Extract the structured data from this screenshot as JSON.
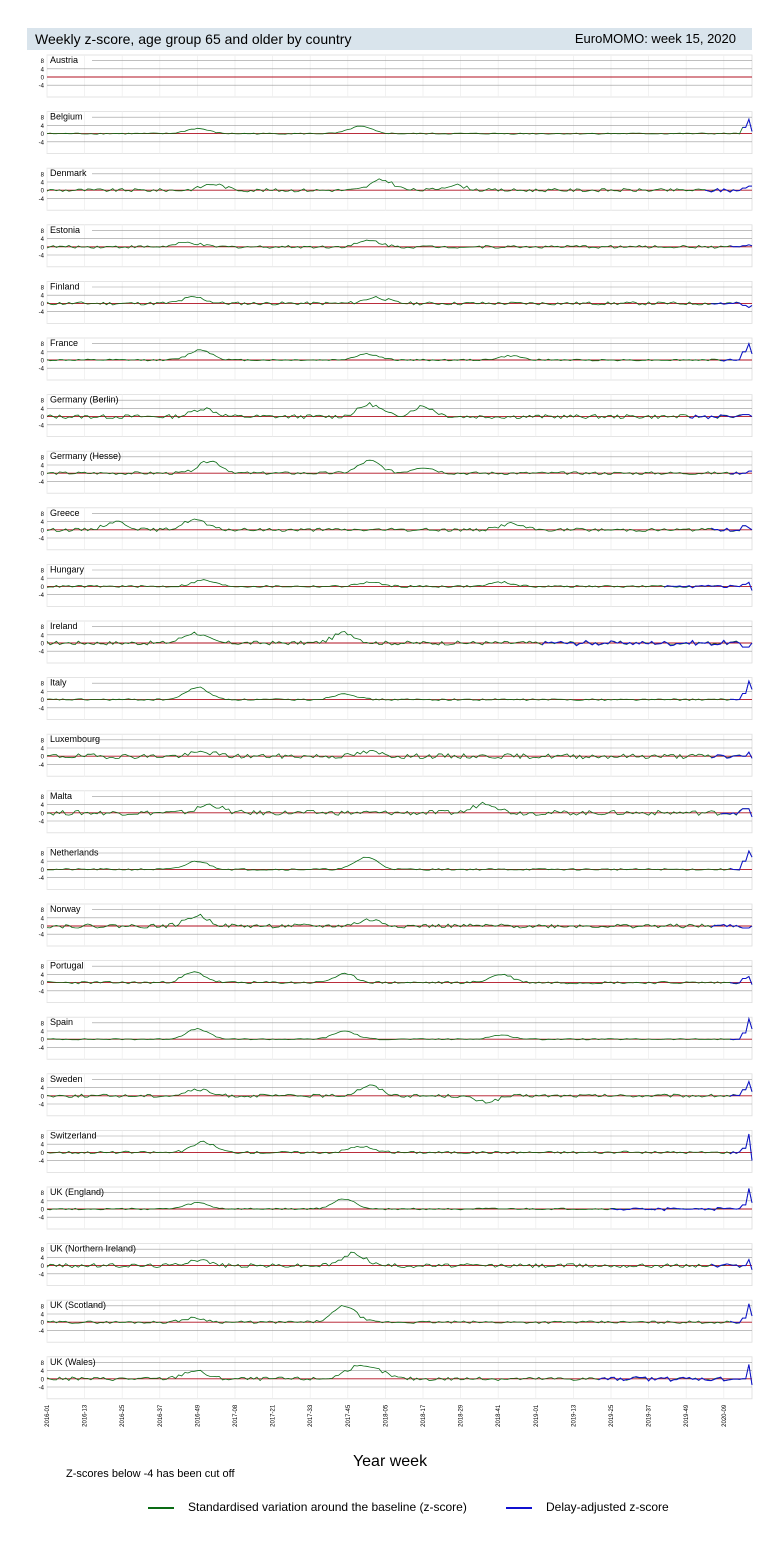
{
  "header": {
    "title": "Weekly z-score, age group 65 and older by country",
    "source": "EuroMOMO: week 15, 2020"
  },
  "footer": {
    "xlabel": "Year week",
    "note": "Z-scores below -4 has been cut off"
  },
  "legend": [
    {
      "label": "Standardised variation around the baseline (z-score)",
      "color": "#0a6b14"
    },
    {
      "label": "Delay-adjusted z-score",
      "color": "#1010d0"
    }
  ],
  "chart_data": {
    "type": "line",
    "title": "Weekly z-score, age group 65 and older by country",
    "xlabel": "Year week",
    "x_ticks": [
      "2016-01",
      "2016-13",
      "2016-25",
      "2016-37",
      "2016-49",
      "2017-08",
      "2017-21",
      "2017-33",
      "2017-45",
      "2018-05",
      "2018-17",
      "2018-29",
      "2018-41",
      "2019-01",
      "2019-13",
      "2019-25",
      "2019-37",
      "2019-49",
      "2020-09"
    ],
    "y_ticks": [
      8,
      4,
      0,
      -4
    ],
    "baseline": 0,
    "grid": true,
    "colors": {
      "zscore": "#0a6b14",
      "delay": "#1010d0",
      "zero": "#b01020",
      "grid": "#cccccc"
    },
    "panels": [
      {
        "country": "Austria",
        "peaks": [],
        "end": [
          0,
          0,
          0
        ],
        "delay_start": null,
        "wave": 0
      },
      {
        "country": "Belgium",
        "peaks": [
          [
            48,
            2.5
          ],
          [
            100,
            3.5
          ]
        ],
        "end": [
          3,
          7,
          1
        ],
        "delay_start": 222,
        "wave": 0.3
      },
      {
        "country": "Denmark",
        "peaks": [
          [
            53,
            3
          ],
          [
            107,
            5
          ],
          [
            130,
            2.5
          ]
        ],
        "end": [
          1,
          2,
          2
        ],
        "delay_start": 210,
        "wave": 0.8
      },
      {
        "country": "Estonia",
        "peaks": [
          [
            45,
            2
          ],
          [
            103,
            3
          ]
        ],
        "end": [
          0.5,
          1,
          0.5
        ],
        "delay_start": 218,
        "wave": 0.7
      },
      {
        "country": "Finland",
        "peaks": [
          [
            47,
            3
          ],
          [
            105,
            3
          ]
        ],
        "end": [
          -1,
          -2,
          -1
        ],
        "delay_start": 212,
        "wave": 0.8
      },
      {
        "country": "France",
        "peaks": [
          [
            49,
            5
          ],
          [
            102,
            3
          ],
          [
            148,
            2
          ]
        ],
        "end": [
          4,
          8,
          3
        ],
        "delay_start": 215,
        "wave": 0.4
      },
      {
        "country": "Germany (Berlin)",
        "peaks": [
          [
            50,
            4
          ],
          [
            103,
            6
          ],
          [
            120,
            5
          ]
        ],
        "end": [
          1,
          1,
          0
        ],
        "delay_start": 205,
        "wave": 1.0
      },
      {
        "country": "Germany (Hesse)",
        "peaks": [
          [
            52,
            6
          ],
          [
            103,
            6
          ],
          [
            120,
            3
          ]
        ],
        "end": [
          0,
          1,
          1
        ],
        "delay_start": 218,
        "wave": 0.7
      },
      {
        "country": "Greece",
        "peaks": [
          [
            47,
            5
          ],
          [
            22,
            4
          ],
          [
            148,
            3
          ]
        ],
        "end": [
          2,
          1,
          0
        ],
        "delay_start": 212,
        "wave": 0.8
      },
      {
        "country": "Hungary",
        "peaks": [
          [
            50,
            3
          ],
          [
            103,
            2
          ],
          [
            145,
            2
          ]
        ],
        "end": [
          1,
          2,
          -2
        ],
        "delay_start": 197,
        "wave": 0.5
      },
      {
        "country": "Ireland",
        "peaks": [
          [
            47,
            5
          ],
          [
            95,
            5
          ]
        ],
        "end": [
          -2,
          -2,
          0
        ],
        "delay_start": 158,
        "wave": 1.0
      },
      {
        "country": "Italy",
        "peaks": [
          [
            48,
            6
          ],
          [
            95,
            3
          ]
        ],
        "end": [
          3,
          9,
          5
        ],
        "delay_start": 218,
        "wave": 0.4
      },
      {
        "country": "Luxembourg",
        "peaks": [
          [
            50,
            2
          ],
          [
            103,
            2
          ]
        ],
        "end": [
          0,
          2,
          -1
        ],
        "delay_start": 212,
        "wave": 1.2
      },
      {
        "country": "Malta",
        "peaks": [
          [
            52,
            4
          ],
          [
            140,
            5
          ]
        ],
        "end": [
          2,
          2,
          -2
        ],
        "delay_start": 215,
        "wave": 1.2
      },
      {
        "country": "Netherlands",
        "peaks": [
          [
            48,
            4
          ],
          [
            102,
            6
          ]
        ],
        "end": [
          4,
          9,
          6
        ],
        "delay_start": 218,
        "wave": 0.4
      },
      {
        "country": "Norway",
        "peaks": [
          [
            48,
            5
          ],
          [
            103,
            3
          ]
        ],
        "end": [
          -1,
          -1,
          0
        ],
        "delay_start": 212,
        "wave": 1.0
      },
      {
        "country": "Portugal",
        "peaks": [
          [
            47,
            5
          ],
          [
            95,
            4
          ],
          [
            145,
            4
          ]
        ],
        "end": [
          2,
          3,
          -1
        ],
        "delay_start": 218,
        "wave": 0.6
      },
      {
        "country": "Spain",
        "peaks": [
          [
            48,
            5
          ],
          [
            95,
            4
          ],
          [
            145,
            2
          ]
        ],
        "end": [
          3,
          10,
          5
        ],
        "delay_start": 218,
        "wave": 0.3
      },
      {
        "country": "Sweden",
        "peaks": [
          [
            48,
            3
          ],
          [
            103,
            5
          ],
          [
            140,
            -3
          ]
        ],
        "end": [
          3,
          7,
          2
        ],
        "delay_start": 218,
        "wave": 0.8
      },
      {
        "country": "Switzerland",
        "peaks": [
          [
            50,
            5
          ],
          [
            100,
            3
          ]
        ],
        "end": [
          2,
          9,
          -4
        ],
        "delay_start": 218,
        "wave": 0.6
      },
      {
        "country": "UK (England)",
        "peaks": [
          [
            48,
            3
          ],
          [
            95,
            5
          ]
        ],
        "end": [
          2,
          10,
          3
        ],
        "delay_start": 180,
        "wave": 0.4
      },
      {
        "country": "UK (Northern Ireland)",
        "peaks": [
          [
            48,
            3
          ],
          [
            98,
            6
          ]
        ],
        "end": [
          0,
          3,
          -2
        ],
        "delay_start": 212,
        "wave": 1.0
      },
      {
        "country": "UK (Scotland)",
        "peaks": [
          [
            47,
            2
          ],
          [
            95,
            8
          ]
        ],
        "end": [
          2,
          9,
          3
        ],
        "delay_start": 218,
        "wave": 0.6
      },
      {
        "country": "UK (Wales)",
        "peaks": [
          [
            47,
            4
          ],
          [
            98,
            5
          ],
          [
            105,
            4
          ]
        ],
        "end": [
          0,
          7,
          -3
        ],
        "delay_start": 176,
        "wave": 0.9
      }
    ]
  }
}
